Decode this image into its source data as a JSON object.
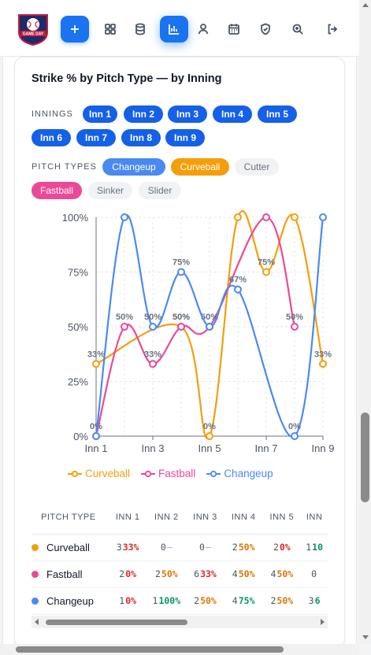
{
  "logo": {
    "text": "GAME DAY",
    "colors": {
      "shield": "#1f2a6b",
      "accent": "#c81e3a"
    }
  },
  "nav": [
    {
      "name": "add-button",
      "icon": "plus-icon",
      "state": "primary"
    },
    {
      "name": "dashboard-button",
      "icon": "grid-icon",
      "state": "normal"
    },
    {
      "name": "database-button",
      "icon": "database-icon",
      "state": "normal"
    },
    {
      "name": "analytics-button",
      "icon": "bar-chart-icon",
      "state": "active"
    },
    {
      "name": "profile-button",
      "icon": "user-icon",
      "state": "normal"
    },
    {
      "name": "calendar-button",
      "icon": "calendar-icon",
      "state": "normal"
    },
    {
      "name": "security-button",
      "icon": "shield-icon",
      "state": "normal"
    },
    {
      "name": "search-button",
      "icon": "zoom-icon",
      "state": "normal"
    },
    {
      "name": "logout-button",
      "icon": "logout-icon",
      "state": "normal"
    }
  ],
  "card": {
    "title": "Strike % by Pitch Type — by Inning",
    "innings_label": "INNINGS",
    "innings": [
      "Inn 1",
      "Inn 2",
      "Inn 3",
      "Inn 4",
      "Inn 5",
      "Inn 6",
      "Inn 7",
      "Inn 8",
      "Inn 9"
    ],
    "pitch_types_label": "PITCH TYPES",
    "pitch_types": [
      {
        "label": "Changeup",
        "selected": true,
        "color": "#4a8af0"
      },
      {
        "label": "Curveball",
        "selected": true,
        "color": "#f59e0b"
      },
      {
        "label": "Cutter",
        "selected": false,
        "color": "#f1f2f4"
      },
      {
        "label": "Fastball",
        "selected": true,
        "color": "#ec4899"
      },
      {
        "label": "Sinker",
        "selected": false,
        "color": "#f1f2f4"
      },
      {
        "label": "Slider",
        "selected": false,
        "color": "#f1f2f4"
      }
    ]
  },
  "chart_data": {
    "type": "line",
    "x": [
      "Inn 1",
      "Inn 2",
      "Inn 3",
      "Inn 4",
      "Inn 5",
      "Inn 6",
      "Inn 7",
      "Inn 8",
      "Inn 9"
    ],
    "x_tick_labels": [
      "Inn 1",
      "Inn 3",
      "Inn 5",
      "Inn 7",
      "Inn 9"
    ],
    "y_tick_labels": [
      "0%",
      "25%",
      "50%",
      "75%",
      "100%"
    ],
    "ylim": [
      0,
      100
    ],
    "grid": true,
    "legend": "bottom",
    "series": [
      {
        "name": "Curveball",
        "color": "#f59e0b",
        "values": [
          33,
          null,
          null,
          50,
          0,
          100,
          75,
          100,
          33
        ],
        "labels": [
          "33%",
          "",
          "",
          "50%",
          "0%",
          "",
          "75%",
          "",
          "33%"
        ]
      },
      {
        "name": "Fastball",
        "color": "#ec4899",
        "values": [
          0,
          50,
          33,
          50,
          50,
          null,
          100,
          50,
          null
        ],
        "labels": [
          "0%",
          "50%",
          "33%",
          "50%",
          "50%",
          "",
          "",
          "50%",
          ""
        ]
      },
      {
        "name": "Changeup",
        "color": "#4a8af0",
        "values": [
          0,
          100,
          50,
          75,
          50,
          67,
          null,
          0,
          100
        ],
        "labels": [
          "",
          "",
          "50%",
          "75%",
          "",
          "67%",
          "",
          "0%",
          ""
        ]
      }
    ]
  },
  "table": {
    "headers": [
      "PITCH TYPE",
      "INN 1",
      "INN 2",
      "INN 3",
      "INN 4",
      "INN 5",
      "INN"
    ],
    "rows": [
      {
        "name": "Curveball",
        "color": "#f59e0b",
        "cells": [
          {
            "n": "3",
            "p": "33%",
            "c": "p-red"
          },
          {
            "n": "0",
            "p": "—",
            "c": "p-gray"
          },
          {
            "n": "0",
            "p": "—",
            "c": "p-gray"
          },
          {
            "n": "2",
            "p": "50%",
            "c": "p-orange"
          },
          {
            "n": "2",
            "p": "0%",
            "c": "p-red"
          },
          {
            "n": "1",
            "p": "10",
            "c": "p-green"
          }
        ]
      },
      {
        "name": "Fastball",
        "color": "#ec4899",
        "cells": [
          {
            "n": "2",
            "p": "0%",
            "c": "p-red"
          },
          {
            "n": "2",
            "p": "50%",
            "c": "p-orange"
          },
          {
            "n": "6",
            "p": "33%",
            "c": "p-red"
          },
          {
            "n": "4",
            "p": "50%",
            "c": "p-orange"
          },
          {
            "n": "4",
            "p": "50%",
            "c": "p-orange"
          },
          {
            "n": "0",
            "p": "",
            "c": "p-gray"
          }
        ]
      },
      {
        "name": "Changeup",
        "color": "#4a8af0",
        "cells": [
          {
            "n": "1",
            "p": "0%",
            "c": "p-red"
          },
          {
            "n": "1",
            "p": "100%",
            "c": "p-green"
          },
          {
            "n": "2",
            "p": "50%",
            "c": "p-orange"
          },
          {
            "n": "4",
            "p": "75%",
            "c": "p-green"
          },
          {
            "n": "2",
            "p": "50%",
            "c": "p-orange"
          },
          {
            "n": "3",
            "p": "6",
            "c": "p-green"
          }
        ]
      }
    ]
  }
}
